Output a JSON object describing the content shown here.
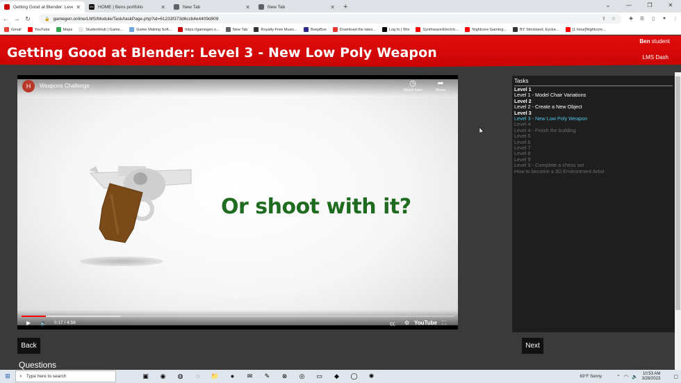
{
  "browser": {
    "tabs": [
      {
        "title": "Getting Good at Blender: Level 3",
        "active": true,
        "favicon_color": "#c80000",
        "favicon_icon": "gamegen-favicon"
      },
      {
        "title": "HOME | Bens portfolio",
        "active": false,
        "favicon_color": "#000000",
        "favicon_icon": "wix-favicon",
        "favicon_text": "WIX"
      },
      {
        "title": "New Tab",
        "active": false,
        "favicon_color": "#5f6368",
        "favicon_icon": "chrome-favicon"
      },
      {
        "title": "New Tab",
        "active": false,
        "favicon_color": "#5f6368",
        "favicon_icon": "chrome-favicon"
      }
    ],
    "url": "gamegen.online/LMS/Module/Task/taskPage.php?id=61233f373d6ccb4e4409d909",
    "bookmarks": [
      {
        "label": "Gmail",
        "color": "#ea4335"
      },
      {
        "label": "YouTube",
        "color": "#ff0000"
      },
      {
        "label": "Maps",
        "color": "#34a853"
      },
      {
        "label": "StudentHub | Game...",
        "color": "#e8e8e8"
      },
      {
        "label": "Game Making Soft...",
        "color": "#6fa8dc"
      },
      {
        "label": "https://gamegen.o...",
        "color": "#c80000"
      },
      {
        "label": "New Tab",
        "color": "#5f6368"
      },
      {
        "label": "Royalty Free Music...",
        "color": "#333333"
      },
      {
        "label": "BeepBox",
        "color": "#2b2b8a"
      },
      {
        "label": "Download the lates...",
        "color": "#e53935"
      },
      {
        "label": "Log In | Wix",
        "color": "#000000"
      },
      {
        "label": "Synthwave/Electric...",
        "color": "#ff0000"
      },
      {
        "label": "Nightcore Gaming...",
        "color": "#ff0000"
      },
      {
        "label": "BY Strickland, Eycke...",
        "color": "#333333"
      },
      {
        "label": "[1 Hour]Nightcore...",
        "color": "#ff0000"
      }
    ]
  },
  "header": {
    "title": "Getting Good at Blender: Level 3 - New Low Poly Weapon",
    "user_name": "Ben",
    "user_role": "student",
    "lms_dash": "LMS Dash"
  },
  "video": {
    "channel_initial": "H",
    "title": "Weapons Challenge",
    "watch_later": "Watch later",
    "share": "Share",
    "overlay_text": "Or shoot with it?",
    "time": "0:17 / 4:58",
    "played_fraction": 0.057,
    "buffered_fraction": 0.23,
    "logo": "YouTube"
  },
  "tasks": {
    "heading": "Tasks",
    "items": [
      {
        "label": "Level 1",
        "state": "done",
        "kind": "level"
      },
      {
        "label": "Level 1 - Model Chair Variations",
        "state": "done",
        "kind": "task"
      },
      {
        "label": "Level 2",
        "state": "done",
        "kind": "level"
      },
      {
        "label": "Level 2 - Create a New Object",
        "state": "done",
        "kind": "task"
      },
      {
        "label": "Level 3",
        "state": "done",
        "kind": "level"
      },
      {
        "label": "Level 3 - New Low Poly Weapon",
        "state": "current",
        "kind": "task"
      },
      {
        "label": "Level 4",
        "state": "locked",
        "kind": "level"
      },
      {
        "label": "Level 4 - Finish the building",
        "state": "locked",
        "kind": "task"
      },
      {
        "label": "Level 5",
        "state": "locked",
        "kind": "level"
      },
      {
        "label": "Level 6",
        "state": "locked",
        "kind": "level"
      },
      {
        "label": "Level 7",
        "state": "locked",
        "kind": "level"
      },
      {
        "label": "Level 8",
        "state": "locked",
        "kind": "level"
      },
      {
        "label": "Level 9",
        "state": "locked",
        "kind": "level"
      },
      {
        "label": "Level 9 - Complete a chess set",
        "state": "locked",
        "kind": "task"
      },
      {
        "label": "How to become a 3D Environment Artist",
        "state": "locked",
        "kind": "task"
      }
    ]
  },
  "nav": {
    "back": "Back",
    "next": "Next"
  },
  "questions_heading": "Questions",
  "taskbar": {
    "search_placeholder": "Type here to search",
    "weather": "63°F  Sunny",
    "time": "10:53 AM",
    "date": "3/28/2023"
  },
  "colors": {
    "brand_red": "#d40808",
    "current_task": "#4fc6e8",
    "overlay_green": "#1f6b1f"
  }
}
